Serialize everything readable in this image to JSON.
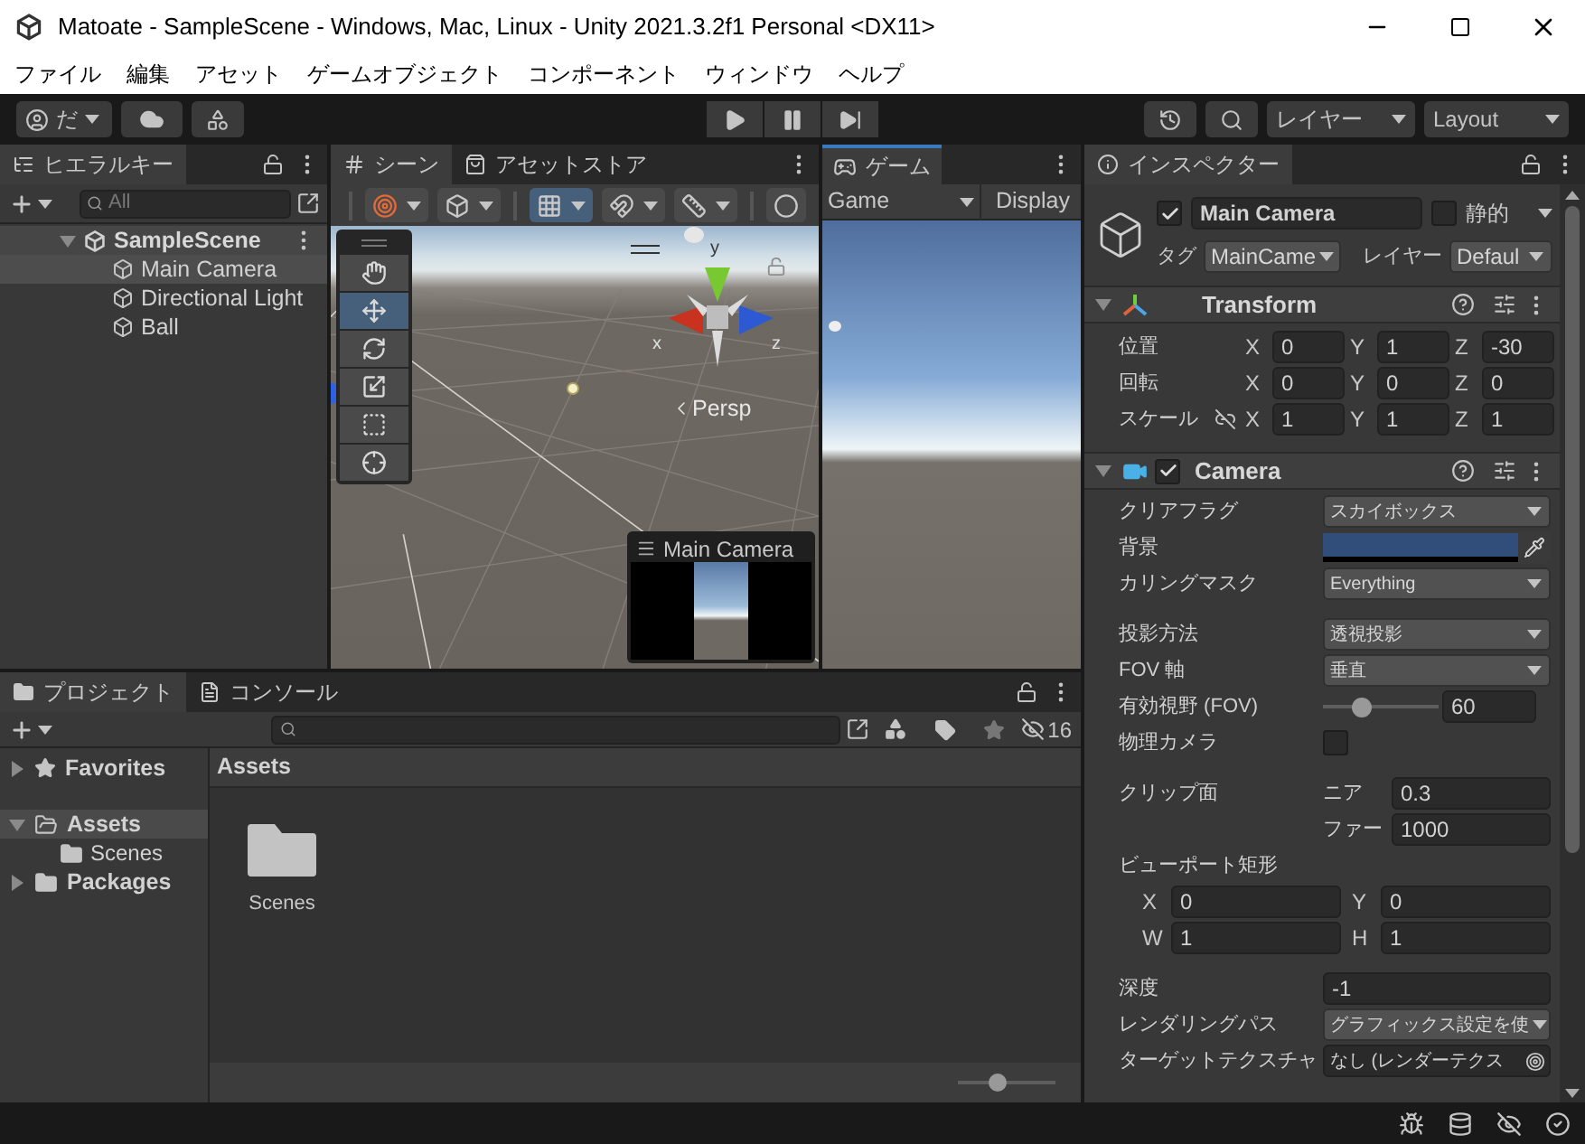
{
  "window": {
    "title": "Matoate - SampleScene - Windows, Mac, Linux - Unity 2021.3.2f1 Personal <DX11>"
  },
  "menu": [
    "ファイル",
    "編集",
    "アセット",
    "ゲームオブジェクト",
    "コンポーネント",
    "ウィンドウ",
    "ヘルプ"
  ],
  "toolbar": {
    "account": "だ",
    "play_controls": [
      {
        "kind": "play"
      },
      {
        "kind": "pause"
      },
      {
        "kind": "step"
      }
    ],
    "layers": "レイヤー",
    "layout": "Layout"
  },
  "hierarchy": {
    "tab": "ヒエラルキー",
    "placeholder": "All",
    "tree": [
      {
        "label": "SampleScene",
        "kind": "scene",
        "expanded": true,
        "selected": false,
        "children": [
          {
            "label": "Main Camera",
            "kind": "object",
            "selected": true
          },
          {
            "label": "Directional Light",
            "kind": "object",
            "selected": false
          },
          {
            "label": "Ball",
            "kind": "object",
            "selected": false
          }
        ]
      }
    ]
  },
  "scene": {
    "tabs": [
      {
        "label": "シーン",
        "kind": "scene",
        "selected": true
      },
      {
        "label": "アセットストア",
        "kind": "store",
        "selected": false
      }
    ],
    "toolbar": [
      {
        "kind": "draw-mode",
        "selected": false
      },
      {
        "kind": "shading",
        "selected": false
      },
      {
        "kind": "grid",
        "selected": true
      },
      {
        "kind": "snap",
        "selected": false
      },
      {
        "kind": "increment",
        "selected": false
      },
      {
        "kind": "gizmos",
        "selected": false
      }
    ],
    "tools": [
      {
        "kind": "hand",
        "selected": false
      },
      {
        "kind": "move",
        "selected": true
      },
      {
        "kind": "rotate",
        "selected": false
      },
      {
        "kind": "scale",
        "selected": false
      },
      {
        "kind": "rect",
        "selected": false
      },
      {
        "kind": "transform",
        "selected": false
      }
    ],
    "gizmo_axes": [
      "y",
      "x",
      "z"
    ],
    "projection": "Persp",
    "camera_preview": {
      "title": "Main Camera"
    }
  },
  "game": {
    "tab": "ゲーム",
    "camera": "Game",
    "display": "Display"
  },
  "inspector": {
    "tab": "インスペクター",
    "object": {
      "active": true,
      "name": "Main Camera",
      "static": false,
      "static_label": "静的",
      "tag_label": "タグ",
      "tag": "MainCame",
      "layer_label": "レイヤー",
      "layer": "Defaul"
    },
    "transform": {
      "title": "Transform",
      "expanded": true,
      "rows": [
        {
          "label": "位置",
          "values": [
            {
              "axis": "X",
              "value": "0"
            },
            {
              "axis": "Y",
              "value": "1"
            },
            {
              "axis": "Z",
              "value": "-30"
            }
          ]
        },
        {
          "label": "回転",
          "values": [
            {
              "axis": "X",
              "value": "0"
            },
            {
              "axis": "Y",
              "value": "0"
            },
            {
              "axis": "Z",
              "value": "0"
            }
          ]
        },
        {
          "label": "スケール",
          "constrained": false,
          "values": [
            {
              "axis": "X",
              "value": "1"
            },
            {
              "axis": "Y",
              "value": "1"
            },
            {
              "axis": "Z",
              "value": "1"
            }
          ]
        }
      ]
    },
    "camera": {
      "title": "Camera",
      "enabled": true,
      "expanded": true,
      "groups": [
        [
          {
            "kind": "dropdown",
            "label": "クリアフラグ",
            "value": "スカイボックス"
          },
          {
            "kind": "color",
            "label": "背景",
            "color": "#314d79"
          },
          {
            "kind": "dropdown",
            "label": "カリングマスク",
            "value": "Everything"
          }
        ],
        [
          {
            "kind": "dropdown",
            "label": "投影方法",
            "value": "透視投影"
          },
          {
            "kind": "dropdown",
            "label": "FOV 軸",
            "value": "垂直"
          },
          {
            "kind": "slider",
            "label": "有効視野 (FOV)",
            "level": 0.33,
            "value": "60"
          },
          {
            "kind": "checkbox",
            "label": "物理カメラ",
            "checked": false
          }
        ],
        [
          {
            "kind": "pair",
            "label": "クリップ面",
            "fields": [
              {
                "label": "ニア",
                "value": "0.3"
              },
              {
                "label": "ファー",
                "value": "1000"
              }
            ]
          },
          {
            "kind": "rect",
            "label": "ビューポート矩形",
            "fields": [
              {
                "axis": "X",
                "value": "0"
              },
              {
                "axis": "Y",
                "value": "0"
              },
              {
                "axis": "W",
                "value": "1"
              },
              {
                "axis": "H",
                "value": "1"
              }
            ]
          }
        ],
        [
          {
            "kind": "field",
            "label": "深度",
            "value": "-1"
          },
          {
            "kind": "dropdown",
            "label": "レンダリングパス",
            "value": "グラフィックス設定を使"
          },
          {
            "kind": "object",
            "label": "ターゲットテクスチャ",
            "value": "なし (レンダーテクス"
          }
        ]
      ]
    }
  },
  "project": {
    "tabs": [
      {
        "label": "プロジェクト",
        "kind": "folder",
        "selected": true
      },
      {
        "label": "コンソール",
        "kind": "console",
        "selected": false
      }
    ],
    "hidden_count": "16",
    "tree": [
      {
        "label": "Favorites",
        "kind": "favorites",
        "expanded": false,
        "selected": false
      },
      {
        "label": "Assets",
        "kind": "folder",
        "expanded": true,
        "selected": true,
        "children": [
          {
            "label": "Scenes",
            "kind": "folder",
            "selected": false
          }
        ]
      },
      {
        "label": "Packages",
        "kind": "folder",
        "expanded": false,
        "selected": false
      }
    ],
    "breadcrumb": "Assets",
    "items": [
      {
        "label": "Scenes",
        "kind": "folder"
      }
    ],
    "zoom": {
      "level": 0.4
    }
  }
}
